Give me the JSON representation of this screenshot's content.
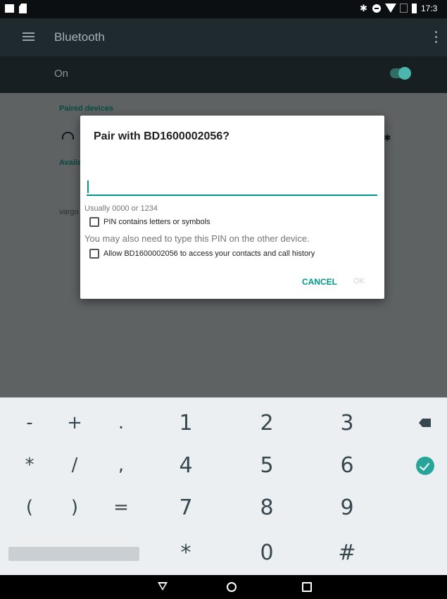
{
  "status_bar": {
    "time": "17:3",
    "icons": [
      "image-icon",
      "sd-card-icon",
      "bluetooth-icon",
      "dnd-icon",
      "wifi-icon",
      "no-sim-icon",
      "battery-icon"
    ]
  },
  "app_bar": {
    "title": "Bluetooth",
    "menu_icon": "hamburger-icon",
    "overflow_icon": "more-vert-icon"
  },
  "bluetooth_toggle": {
    "label": "On",
    "state": "on"
  },
  "background_list": {
    "paired_header": "Paired devices",
    "available_header": "Availa",
    "device_partial": "vargo"
  },
  "dialog": {
    "title": "Pair with BD1600002056?",
    "pin_value": "",
    "hint": "Usually 0000 or 1234",
    "checkbox_pin_symbols": "PIN contains letters or symbols",
    "info": "You may also need to type this PIN on the other device.",
    "checkbox_contacts": "Allow BD1600002056 to access your contacts and call history",
    "cancel": "CANCEL",
    "ok": "OK"
  },
  "keyboard": {
    "row1": [
      "-",
      "+",
      ".",
      "1",
      "2",
      "3"
    ],
    "row2": [
      "*",
      "/",
      ",",
      "4",
      "5",
      "6"
    ],
    "row3": [
      "(",
      ")",
      "=",
      "7",
      "8",
      "9"
    ],
    "row4": [
      "*",
      "0",
      "#"
    ]
  },
  "colors": {
    "accent": "#009688",
    "toggle": "#4db6ac"
  }
}
